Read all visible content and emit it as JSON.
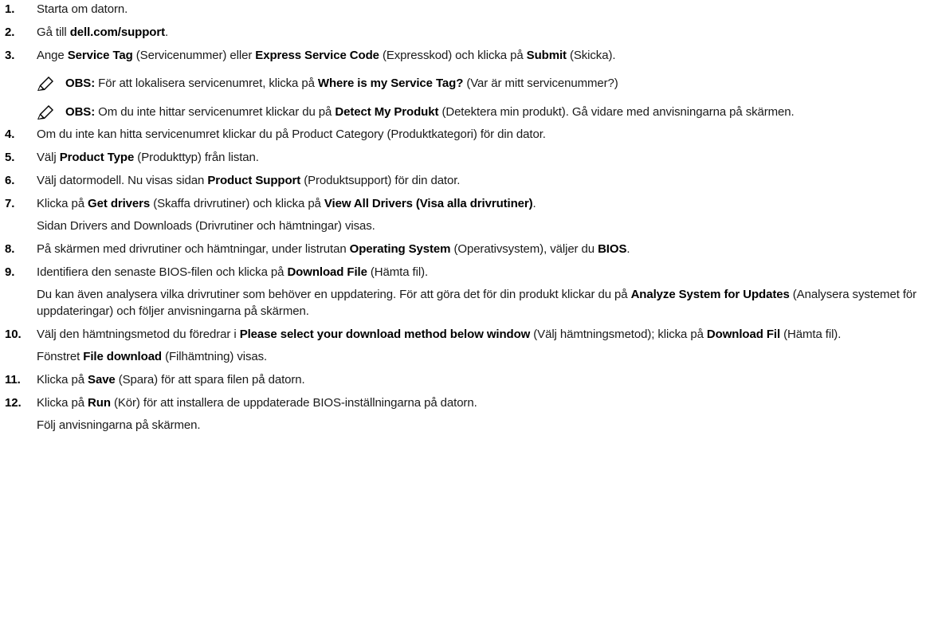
{
  "steps": [
    {
      "num": "1.",
      "parts": [
        {
          "t": "Starta om datorn."
        }
      ]
    },
    {
      "num": "2.",
      "parts": [
        {
          "t": "Gå till "
        },
        {
          "b": "dell.com/support"
        },
        {
          "t": "."
        }
      ]
    },
    {
      "num": "3.",
      "parts": [
        {
          "t": "Ange "
        },
        {
          "b": "Service Tag"
        },
        {
          "t": " (Servicenummer) eller "
        },
        {
          "b": "Express Service Code"
        },
        {
          "t": " (Expresskod) och klicka på "
        },
        {
          "b": "Submit"
        },
        {
          "t": " (Skicka)."
        }
      ]
    },
    {
      "num": "4.",
      "parts": [
        {
          "t": "Om du inte kan hitta servicenumret klickar du på Product Category (Produktkategori) för din dator."
        }
      ]
    },
    {
      "num": "5.",
      "parts": [
        {
          "t": "Välj "
        },
        {
          "b": "Product Type"
        },
        {
          "t": " (Produkttyp) från listan."
        }
      ]
    },
    {
      "num": "6.",
      "parts": [
        {
          "t": "Välj datormodell. Nu visas sidan "
        },
        {
          "b": "Product Support"
        },
        {
          "t": " (Produktsupport) för din dator."
        }
      ]
    },
    {
      "num": "7.",
      "parts": [
        {
          "t": "Klicka på "
        },
        {
          "b": "Get drivers"
        },
        {
          "t": " (Skaffa drivrutiner) och klicka på "
        },
        {
          "b": "View All Drivers (Visa alla drivrutiner)"
        },
        {
          "t": "."
        }
      ],
      "extra": "Sidan Drivers and Downloads (Drivrutiner och hämtningar) visas."
    },
    {
      "num": "8.",
      "parts": [
        {
          "t": "På skärmen med drivrutiner och hämtningar, under listrutan "
        },
        {
          "b": "Operating System"
        },
        {
          "t": " (Operativsystem), väljer du "
        },
        {
          "b": "BIOS"
        },
        {
          "t": "."
        }
      ]
    },
    {
      "num": "9.",
      "parts": [
        {
          "t": "Identifiera den senaste BIOS-filen och klicka på "
        },
        {
          "b": "Download File"
        },
        {
          "t": " (Hämta fil)."
        }
      ],
      "extra_parts": [
        {
          "t": "Du kan även analysera vilka drivrutiner som behöver en uppdatering. För att göra det för din produkt klickar du på "
        },
        {
          "b": "Analyze System for Updates"
        },
        {
          "t": " (Analysera systemet för uppdateringar) och följer anvisningarna på skärmen."
        }
      ]
    },
    {
      "num": "10.",
      "parts": [
        {
          "t": "Välj den hämtningsmetod du föredrar i "
        },
        {
          "b": "Please select your download method below window"
        },
        {
          "t": " (Välj hämtningsmetod); klicka på "
        },
        {
          "b": "Download Fil"
        },
        {
          "t": " (Hämta fil)."
        }
      ],
      "extra_parts": [
        {
          "t": "Fönstret "
        },
        {
          "b": "File download"
        },
        {
          "t": " (Filhämtning) visas."
        }
      ]
    },
    {
      "num": "11.",
      "parts": [
        {
          "t": "Klicka på "
        },
        {
          "b": "Save"
        },
        {
          "t": " (Spara) för att spara filen på datorn."
        }
      ]
    },
    {
      "num": "12.",
      "parts": [
        {
          "t": "Klicka på "
        },
        {
          "b": "Run"
        },
        {
          "t": " (Kör) för att installera de uppdaterade BIOS-inställningarna på datorn."
        }
      ],
      "extra": "Följ anvisningarna på skärmen."
    }
  ],
  "notes": [
    {
      "parts": [
        {
          "b": "OBS:"
        },
        {
          "t": " För att lokalisera servicenumret, klicka på "
        },
        {
          "b": "Where is my Service Tag?"
        },
        {
          "t": " (Var är mitt servicenummer?)"
        }
      ]
    },
    {
      "parts": [
        {
          "b": "OBS:"
        },
        {
          "t": " Om du inte hittar servicenumret klickar du på "
        },
        {
          "b": "Detect My Produkt"
        },
        {
          "t": " (Detektera min produkt). Gå vidare med anvisningarna på skärmen."
        }
      ]
    }
  ],
  "icons": {
    "note": "pencil-note-icon"
  },
  "colors": {
    "text": "#1a1a1a",
    "note_icon": "#000000"
  }
}
